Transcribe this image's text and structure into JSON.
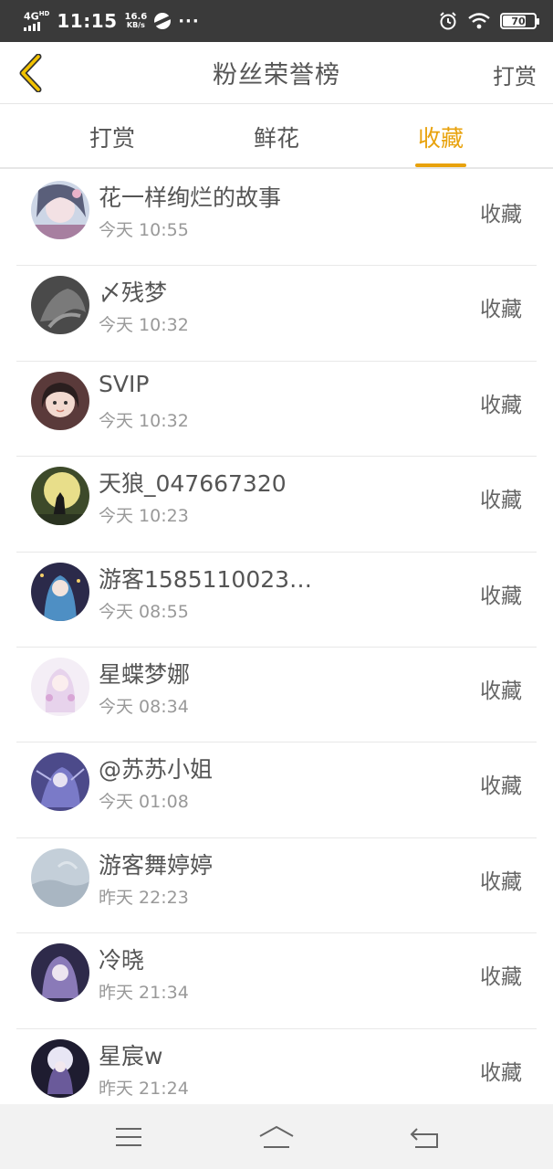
{
  "status_bar": {
    "network": "4G",
    "network_hd": "HD",
    "time": "11:15",
    "speed_value": "16.6",
    "speed_unit": "KB/s",
    "more_glyph": "···",
    "battery": "70"
  },
  "header": {
    "back_icon": "chevron-left-icon",
    "title": "粉丝荣誉榜",
    "action": "打赏"
  },
  "tabs": [
    {
      "label": "打赏",
      "active": false
    },
    {
      "label": "鲜花",
      "active": false
    },
    {
      "label": "收藏",
      "active": true
    }
  ],
  "accent_color": "#e8a20c",
  "list": [
    {
      "name": "花一样绚烂的故事",
      "time": "今天 10:55",
      "kind": "收藏"
    },
    {
      "name": "〆残梦",
      "time": "今天 10:32",
      "kind": "收藏"
    },
    {
      "name": "SVIP",
      "time": "今天 10:32",
      "kind": "收藏"
    },
    {
      "name": "天狼_047667320",
      "time": "今天 10:23",
      "kind": "收藏"
    },
    {
      "name": "游客1585110023…",
      "time": "今天 08:55",
      "kind": "收藏"
    },
    {
      "name": "星蝶梦娜",
      "time": "今天 08:34",
      "kind": "收藏"
    },
    {
      "name": "@苏苏小姐",
      "time": "今天 01:08",
      "kind": "收藏"
    },
    {
      "name": "游客舞婷婷",
      "time": "昨天 22:23",
      "kind": "收藏"
    },
    {
      "name": "冷晓",
      "time": "昨天 21:34",
      "kind": "收藏"
    },
    {
      "name": "星宸w",
      "time": "昨天 21:24",
      "kind": "收藏"
    }
  ],
  "nav": {
    "menu_icon": "menu-icon",
    "home_icon": "home-icon",
    "back_icon": "back-arrow-icon"
  }
}
